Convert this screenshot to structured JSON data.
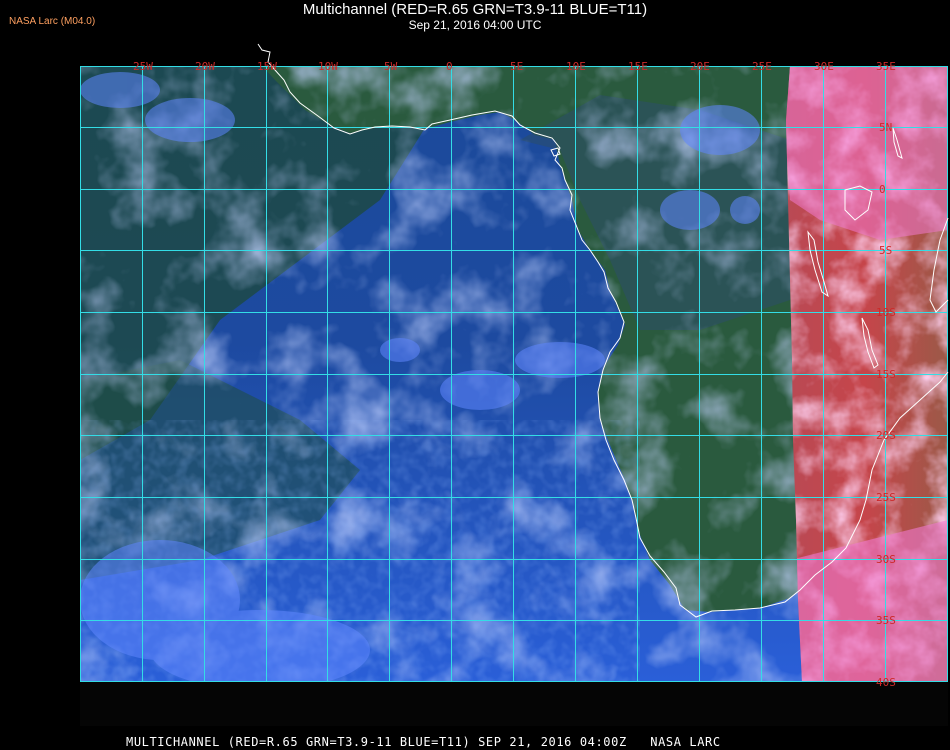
{
  "header": {
    "version_tag": "NASA Larc (M04.0)",
    "title": "Multichannel (RED=R.65 GRN=T3.9-11 BLUE=T11)",
    "subtitle": "Sep 21, 2016 04:00 UTC"
  },
  "footer": {
    "caption": "MULTICHANNEL (RED=R.65 GRN=T3.9-11 BLUE=T11) SEP 21, 2016 04:00Z   NASA LARC"
  },
  "map": {
    "product": "Multichannel satellite composite",
    "longitude_labels": [
      "25W",
      "20W",
      "15W",
      "10W",
      "5W",
      "0",
      "5E",
      "10E",
      "15E",
      "20E",
      "25E",
      "30E",
      "35E"
    ],
    "latitude_labels": [
      "5N",
      "0",
      "5S",
      "10S",
      "15S",
      "20S",
      "25S",
      "30S",
      "35S",
      "40S"
    ],
    "colors": {
      "ocean_night": "#1a4aa8",
      "land_night": "#1d4d2f",
      "daylight_cloud": "#ff7ac8",
      "daylight_land": "#c44a3a",
      "graticule": "#33dde6",
      "coastline": "#ffffff",
      "grid_label": "#cc2a2a",
      "version_tag": "#ffa060"
    }
  }
}
